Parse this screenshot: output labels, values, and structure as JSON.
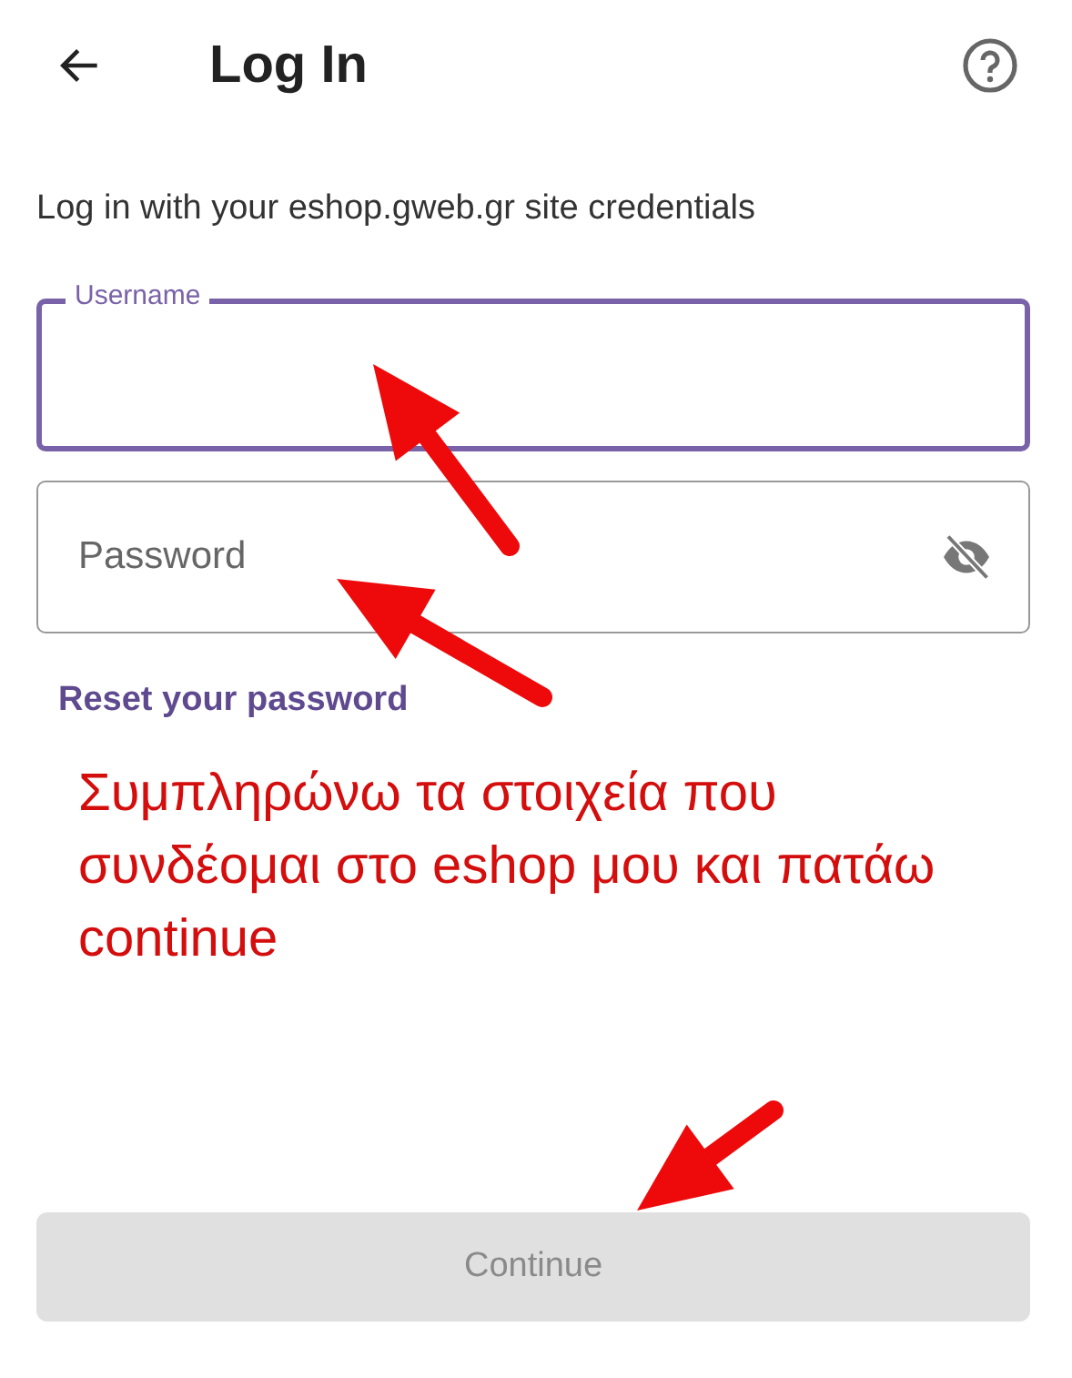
{
  "header": {
    "title": "Log In"
  },
  "subtitle": "Log in with your eshop.gweb.gr site credentials",
  "fields": [
    {
      "kind": "text",
      "label": "Username",
      "focused": true
    },
    {
      "kind": "password",
      "placeholder": "Password",
      "focused": false
    }
  ],
  "reset_link": "Reset your password",
  "annotation": "Συμπληρώνω τα στοιχεία που συνδέομαι στο eshop μου και πατάω continue",
  "continue_button": {
    "label": "Continue",
    "disabled": true
  }
}
